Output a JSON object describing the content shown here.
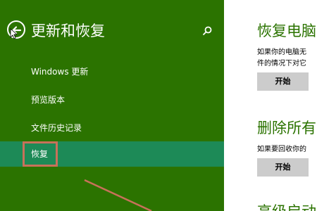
{
  "sidebar": {
    "title": "更新和恢复",
    "back_icon": "back-arrow-icon",
    "search_icon": "search-icon",
    "items": [
      {
        "label": "Windows 更新"
      },
      {
        "label": "预览版本"
      },
      {
        "label": "文件历史记录"
      },
      {
        "label": "恢复",
        "selected": true
      }
    ]
  },
  "content": {
    "sections": [
      {
        "heading": "恢复电脑",
        "desc_lines": [
          "如果你的电脑无",
          "件的情况下对它"
        ],
        "button_label": "开始"
      },
      {
        "heading": "删除所有",
        "desc_lines": [
          "如果要回收你的"
        ],
        "button_label": "开始"
      },
      {
        "heading": "高级启动"
      }
    ]
  },
  "colors": {
    "sidebar_bg": "#2b7300",
    "selected_item_bg": "#1d8a57",
    "accent_text": "#2b7300",
    "annotation": "#c8715a"
  }
}
